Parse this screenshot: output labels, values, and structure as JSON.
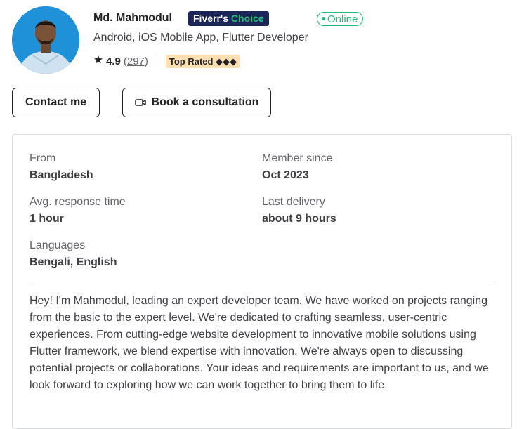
{
  "profile": {
    "name": "Md. Mahmodul",
    "choice_badge_prefix": "Fiverr's",
    "choice_badge_highlight": "Choice",
    "status": "Online",
    "subtitle": "Android, iOS Mobile App, Flutter Developer",
    "rating": "4.9",
    "review_count": "(297)",
    "level_badge": "Top Rated",
    "level_badge_icon": "◆◆◆"
  },
  "actions": {
    "contact_label": "Contact me",
    "book_label": "Book a consultation"
  },
  "stats": {
    "from_label": "From",
    "from_value": "Bangladesh",
    "member_label": "Member since",
    "member_value": "Oct 2023",
    "response_label": "Avg. response time",
    "response_value": "1 hour",
    "delivery_label": "Last delivery",
    "delivery_value": "about 9 hours",
    "languages_label": "Languages",
    "languages_value": "Bengali, English"
  },
  "description": "Hey! I'm Mahmodul, leading an expert developer team. We have worked on projects ranging from the basic to the expert level. We're dedicated to crafting seamless, user-centric experiences. From cutting-edge website development to innovative mobile solutions using Flutter framework, we blend expertise with innovation. We're always open to discussing potential projects or collaborations. Your ideas and requirements are important to us, and we look forward to exploring how we can work together to bring them to life.",
  "colors": {
    "accent_green": "#1dbf73",
    "choice_badge_bg": "#1b2557",
    "top_rated_bg": "#ffe0b3",
    "text_primary": "#404145"
  },
  "icons": {
    "star": "star-icon",
    "camera": "video-camera-icon"
  }
}
